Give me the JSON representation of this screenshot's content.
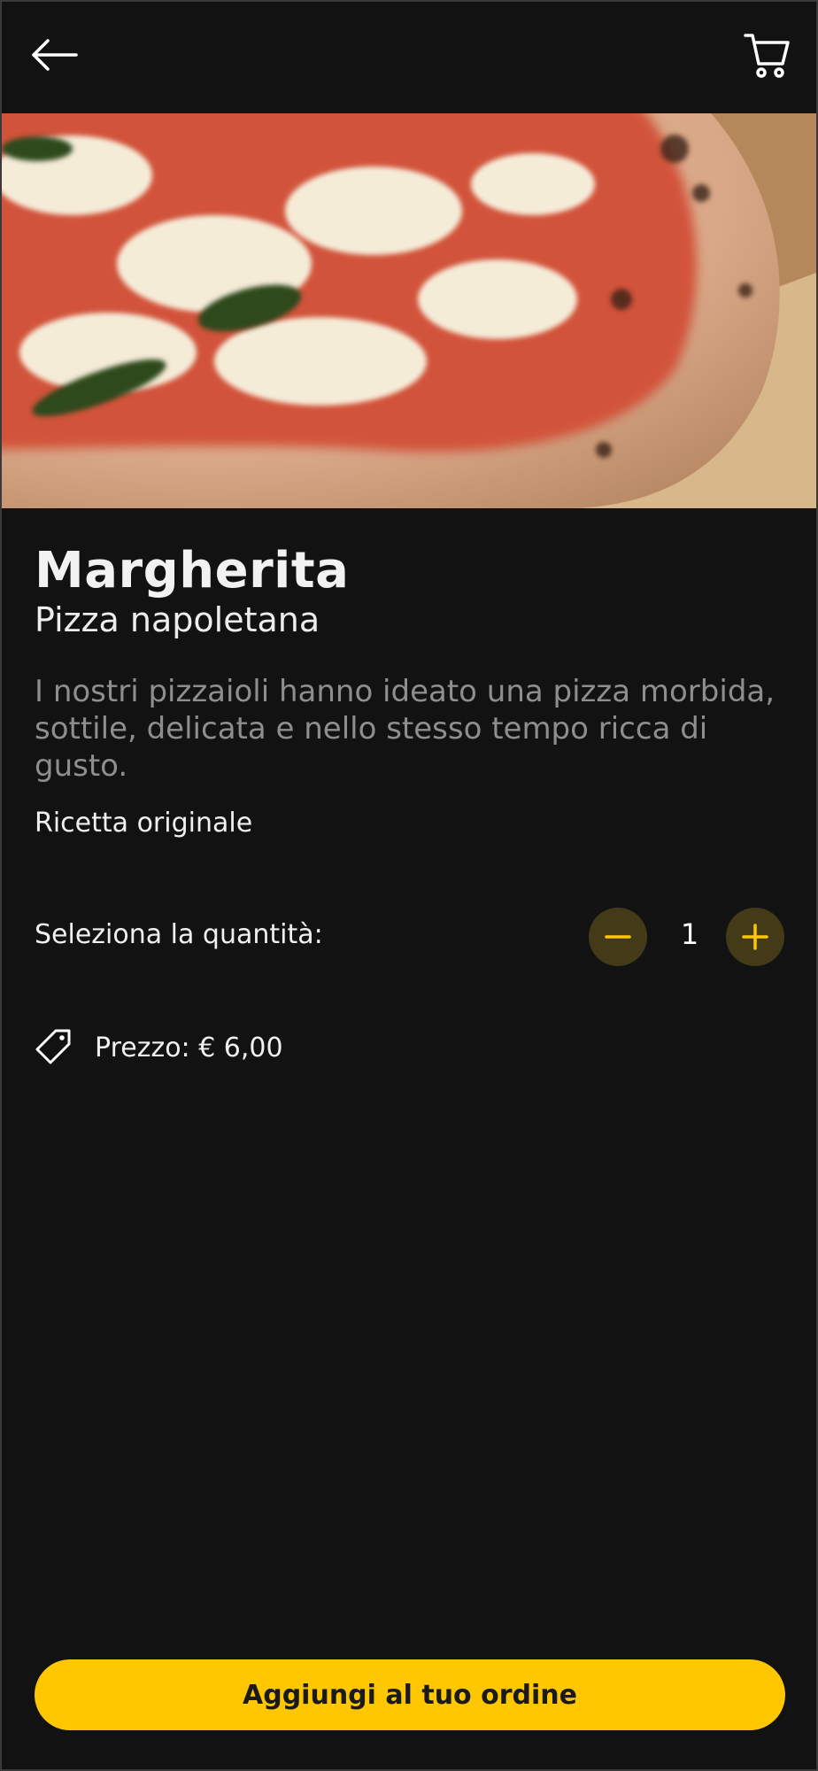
{
  "product": {
    "name": "Margherita",
    "subtitle": "Pizza napoletana",
    "description": "I nostri pizzaioli hanno ideato una pizza morbida, sottile, delicata e nello stesso tempo ricca di gusto.",
    "recipe_note": "Ricetta originale",
    "image_icon": "pizza-photo"
  },
  "quantity": {
    "label": "Seleziona la quantità:",
    "value": "1"
  },
  "price": {
    "label": "Prezzo: € 6,00",
    "icon": "price-tag-icon"
  },
  "actions": {
    "back_icon": "arrow-left-icon",
    "cart_icon": "cart-icon",
    "add_to_order": "Aggiungi al tuo ordine"
  },
  "colors": {
    "background": "#121212",
    "accent": "#ffc700",
    "stepper_bg": "#433a17",
    "muted_text": "#8e8e8e"
  }
}
